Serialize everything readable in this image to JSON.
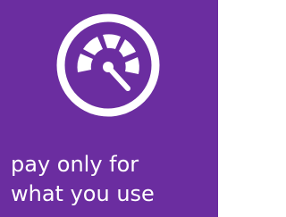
{
  "tile": {
    "background_color": "#6B2DA0",
    "icon": "speedometer-gauge-icon",
    "caption_lines": [
      "pay only for",
      "what you use"
    ]
  }
}
